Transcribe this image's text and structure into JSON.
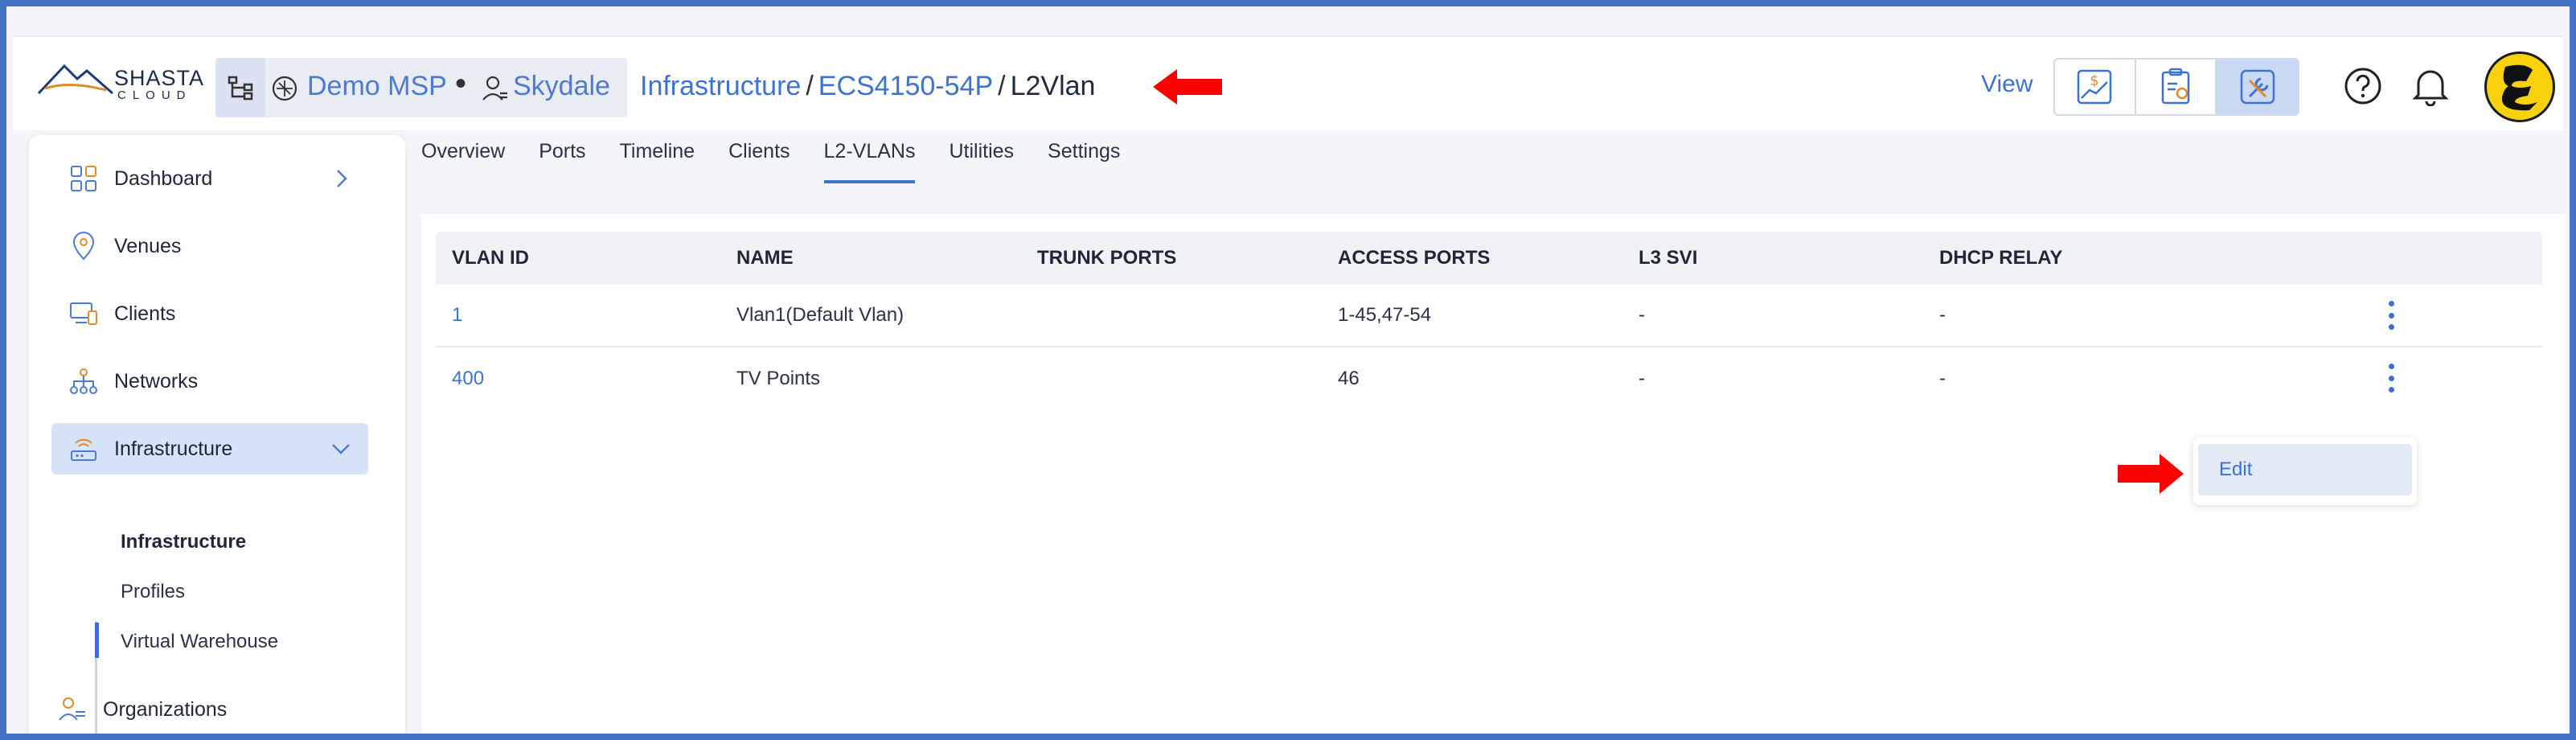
{
  "brand": {
    "name": "SHASTA",
    "sub": "CLOUD"
  },
  "breadcrumb": {
    "msp": "Demo MSP",
    "separator_dot": "•",
    "org": "Skydale",
    "path": [
      {
        "label": "Infrastructure",
        "link": true
      },
      {
        "label": "ECS4150-54P",
        "link": true
      },
      {
        "label": "L2Vlan",
        "link": false
      }
    ],
    "sep": "/"
  },
  "header": {
    "view_label": "View",
    "view_buttons": [
      "billing-chart-icon",
      "report-clipboard-icon",
      "tools-wrench-icon"
    ],
    "active_view": 2
  },
  "sidebar": {
    "items": [
      {
        "label": "Dashboard",
        "icon": "dashboard-grid-icon"
      },
      {
        "label": "Venues",
        "icon": "location-pin-icon"
      },
      {
        "label": "Clients",
        "icon": "devices-icon"
      },
      {
        "label": "Networks",
        "icon": "network-tree-icon"
      },
      {
        "label": "Infrastructure",
        "icon": "router-icon",
        "active": true
      },
      {
        "label": "Organizations",
        "icon": "users-icon"
      }
    ],
    "sub_items": [
      {
        "label": "Infrastructure",
        "active": true
      },
      {
        "label": "Profiles"
      },
      {
        "label": "Virtual Warehouse"
      }
    ]
  },
  "tabs": [
    "Overview",
    "Ports",
    "Timeline",
    "Clients",
    "L2-VLANs",
    "Utilities",
    "Settings"
  ],
  "active_tab": "L2-VLANs",
  "table": {
    "headers": [
      "VLAN ID",
      "NAME",
      "TRUNK PORTS",
      "ACCESS PORTS",
      "L3 SVI",
      "DHCP RELAY"
    ],
    "rows": [
      {
        "vlan_id": "1",
        "name": "Vlan1(Default Vlan)",
        "trunk_ports": "",
        "access_ports": "1-45,47-54",
        "l3_svi": "-",
        "dhcp_relay": "-"
      },
      {
        "vlan_id": "400",
        "name": "TV Points",
        "trunk_ports": "",
        "access_ports": "46",
        "l3_svi": "-",
        "dhcp_relay": "-"
      }
    ]
  },
  "context_menu": {
    "items": [
      "Edit"
    ]
  },
  "colors": {
    "accent": "#3d73d0",
    "annotation_arrow": "#ff0000",
    "frame": "#4472c4"
  }
}
